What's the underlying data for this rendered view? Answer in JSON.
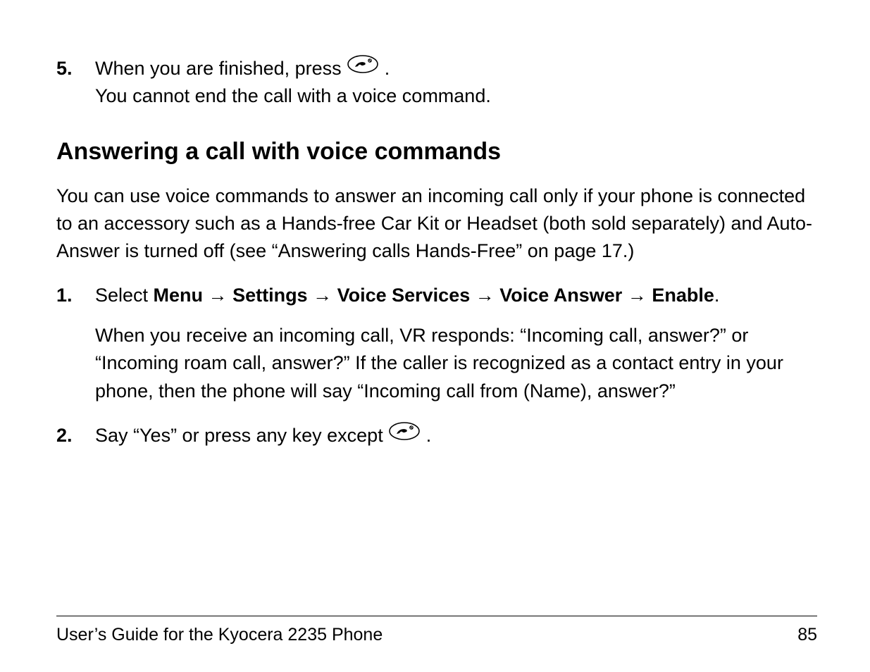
{
  "block5": {
    "num": "5.",
    "line1_before_icon": "When you are finished, press ",
    "line1_after_icon": ".",
    "line2": "You cannot end the call with a voice command."
  },
  "heading": "Answering a call with voice commands",
  "intro_para": "You can use voice commands to answer an incoming call only if your phone is connected to an accessory such as a Hands-free Car Kit or Headset (both sold separately) and Auto-Answer is turned off (see “Answering calls Hands-Free” on page 17.)",
  "step1": {
    "num": "1.",
    "select_word": "Select ",
    "menu": "Menu",
    "settings": "Settings",
    "voice_services": "Voice Services",
    "voice_answer": "Voice Answer",
    "enable": "Enable",
    "arrow": " → ",
    "period": ".",
    "followup": "When you receive an incoming call, VR responds: “Incoming call, answer?” or “Incoming roam call, answer?” If the caller is recognized as a contact entry in your phone, then the phone will say “Incoming call from (Name), answer?”"
  },
  "step2": {
    "num": "2.",
    "before_icon": "Say “Yes” or press any key except ",
    "after_icon": "."
  },
  "footer": {
    "title": "User’s Guide for the Kyocera 2235 Phone",
    "page": "85"
  }
}
